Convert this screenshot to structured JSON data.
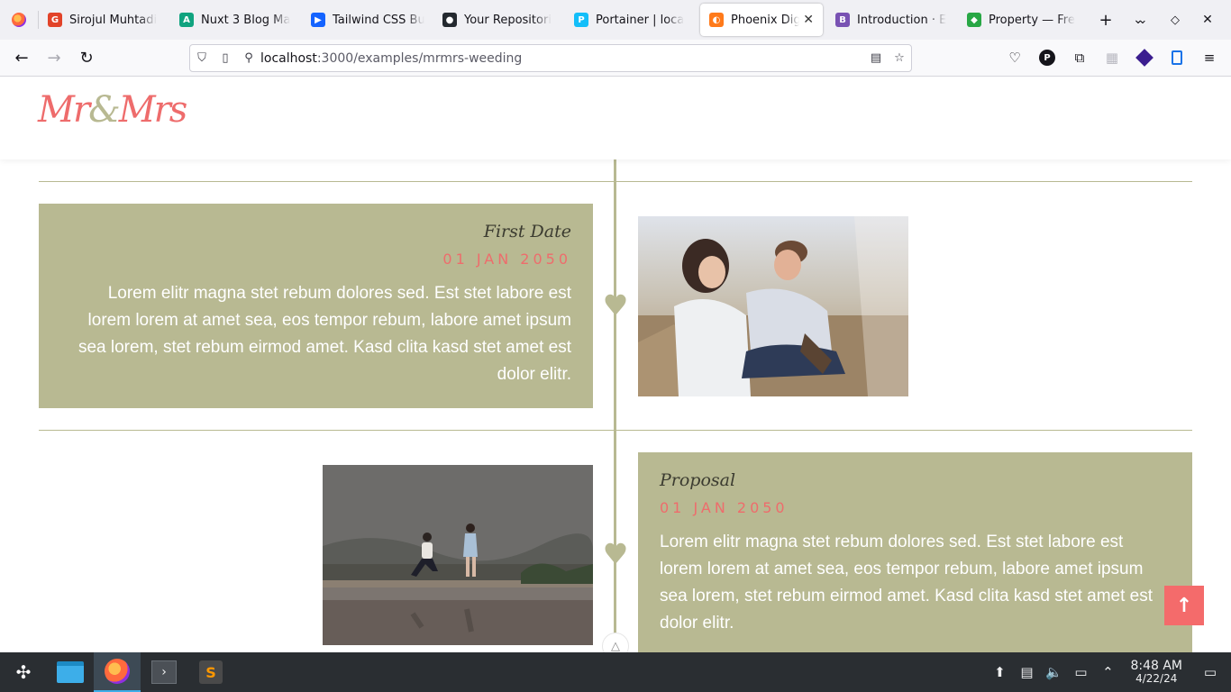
{
  "browser": {
    "tabs": [
      {
        "title": "Sirojul Muhtadi",
        "color": "#e24329",
        "glyph": "G"
      },
      {
        "title": "Nuxt 3 Blog Ma",
        "color": "#10a37f",
        "glyph": "A"
      },
      {
        "title": "Tailwind CSS Bu",
        "color": "#1463ff",
        "glyph": "▶"
      },
      {
        "title": "Your Repositori",
        "color": "#24292f",
        "glyph": "●"
      },
      {
        "title": "Portainer | loca",
        "color": "#13bef9",
        "glyph": "P"
      },
      {
        "title": "Phoenix Digi",
        "color": "#ff7a1a",
        "glyph": "◐",
        "active": true
      },
      {
        "title": "Introduction · E",
        "color": "#7952b3",
        "glyph": "B"
      },
      {
        "title": "Property — Fre",
        "color": "#28a745",
        "glyph": "◆"
      }
    ],
    "url_host": "localhost",
    "url_rest": ":3000/examples/mrmrs-weeding"
  },
  "site": {
    "logo_mr": "Mr",
    "logo_amp": "&",
    "logo_mrs": "Mrs"
  },
  "timeline": [
    {
      "title": "First Date",
      "date": "01 JAN 2050",
      "text": "Lorem elitr magna stet rebum dolores sed. Est stet labore est lorem lorem at amet sea, eos tempor rebum, labore amet ipsum sea lorem, stet rebum eirmod amet. Kasd clita kasd stet amet est dolor elitr."
    },
    {
      "title": "Proposal",
      "date": "01 JAN 2050",
      "text": "Lorem elitr magna stet rebum dolores sed. Est stet labore est lorem lorem at amet sea, eos tempor rebum, labore amet ipsum sea lorem, stet rebum eirmod amet. Kasd clita kasd stet amet est dolor elitr."
    }
  ],
  "colors": {
    "accent": "#ee6c6c",
    "olive": "#b8b992"
  },
  "taskbar": {
    "time": "8:48 AM",
    "date": "4/22/24"
  }
}
